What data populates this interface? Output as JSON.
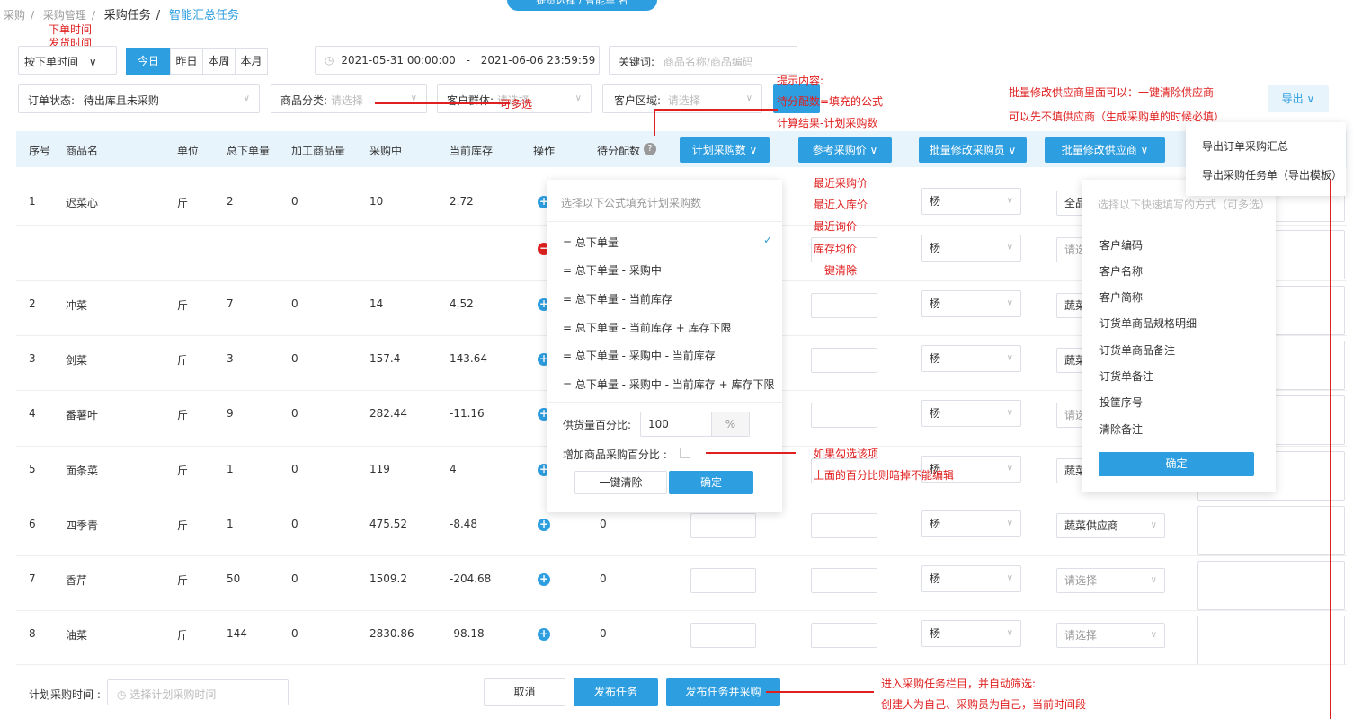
{
  "breadcrumb": {
    "items": [
      "采购",
      "采购管理",
      "采购任务",
      "智能汇总任务"
    ],
    "sep": "/"
  },
  "top_tab": "提货选择 / 智能单 名",
  "filters": {
    "time_type": "按下单时间",
    "time_options": [
      "下单时间",
      "发货时间"
    ],
    "quick_dates": [
      "今日",
      "昨日",
      "本周",
      "本月"
    ],
    "date_start": "2021-05-31 00:00:00",
    "date_sep": "-",
    "date_end": "2021-06-06 23:59:59",
    "keyword_label": "关键词:",
    "keyword_ph": "商品名称/商品编码",
    "order_status_label": "订单状态:",
    "order_status_value": "待出库且未采购",
    "category_label": "商品分类:",
    "category_ph": "请选择",
    "group_label": "客户群体:",
    "group_ph": "请选择",
    "region_label": "客户区域:",
    "region_ph": "请选择",
    "export": "导出"
  },
  "table": {
    "headers": [
      "序号",
      "商品名",
      "单位",
      "总下单量",
      "加工商品量",
      "采购中",
      "当前库存",
      "操作",
      "待分配数"
    ],
    "hbtns": [
      "计划采购数",
      "参考采购价",
      "批量修改采购员",
      "批量修改供应商"
    ],
    "rows": [
      {
        "no": "1",
        "name": "迟菜心",
        "unit": "斤",
        "total": "2",
        "proc": "0",
        "buying": "10",
        "stock": "2.72",
        "alloc": "",
        "buyer": "杨",
        "supplier": "全品"
      },
      {
        "no": "",
        "name": "",
        "unit": "",
        "total": "",
        "proc": "",
        "buying": "",
        "stock": "",
        "alloc": "",
        "buyer": "杨",
        "supplier": "请选"
      },
      {
        "no": "2",
        "name": "冲菜",
        "unit": "斤",
        "total": "7",
        "proc": "0",
        "buying": "14",
        "stock": "4.52",
        "alloc": "",
        "buyer": "杨",
        "supplier": "蔬菜"
      },
      {
        "no": "3",
        "name": "剑菜",
        "unit": "斤",
        "total": "3",
        "proc": "0",
        "buying": "157.4",
        "stock": "143.64",
        "alloc": "",
        "buyer": "杨",
        "supplier": "蔬菜"
      },
      {
        "no": "4",
        "name": "番薯叶",
        "unit": "斤",
        "total": "9",
        "proc": "0",
        "buying": "282.44",
        "stock": "-11.16",
        "alloc": "",
        "buyer": "杨",
        "supplier": "请选"
      },
      {
        "no": "5",
        "name": "面条菜",
        "unit": "斤",
        "total": "1",
        "proc": "0",
        "buying": "119",
        "stock": "4",
        "alloc": "",
        "buyer": "杨",
        "supplier": "蔬菜"
      },
      {
        "no": "6",
        "name": "四季青",
        "unit": "斤",
        "total": "1",
        "proc": "0",
        "buying": "475.52",
        "stock": "-8.48",
        "alloc": "0",
        "buyer": "杨",
        "supplier": "蔬菜供应商"
      },
      {
        "no": "7",
        "name": "香芹",
        "unit": "斤",
        "total": "50",
        "proc": "0",
        "buying": "1509.2",
        "stock": "-204.68",
        "alloc": "0",
        "buyer": "杨",
        "supplier": "请选择"
      },
      {
        "no": "8",
        "name": "油菜",
        "unit": "斤",
        "total": "144",
        "proc": "0",
        "buying": "2830.86",
        "stock": "-98.18",
        "alloc": "0",
        "buyer": "杨",
        "supplier": "请选择"
      }
    ]
  },
  "formula_popup": {
    "title": "选择以下公式填充计划采购数",
    "items": [
      "= 总下单量",
      "= 总下单量 - 采购中",
      "= 总下单量 - 当前库存",
      "= 总下单量 - 当前库存 + 库存下限",
      "= 总下单量 - 采购中 - 当前库存",
      "= 总下单量 - 采购中 - 当前库存 + 库存下限"
    ],
    "pct_label": "供货量百分比:",
    "pct_value": "100",
    "pct_unit": "%",
    "add_pct_label": "增加商品采购百分比 :",
    "clear": "一键清除",
    "confirm": "确定"
  },
  "supplier_popup": {
    "title": "选择以下快速填写的方式（可多选）",
    "items": [
      "客户编码",
      "客户名称",
      "客户简称",
      "订货单商品规格明细",
      "订货单商品备注",
      "订货单备注",
      "投筐序号",
      "清除备注"
    ],
    "confirm": "确定"
  },
  "export_menu": [
    "导出订单采购汇总",
    "导出采购任务单（导出模板）"
  ],
  "footer": {
    "plan_time_label": "计划采购时间 :",
    "plan_time_ph": "选择计划采购时间",
    "cancel": "取消",
    "publish": "发布任务",
    "publish_buy": "发布任务并采购"
  },
  "annotations": {
    "tip_title": "提示内容:",
    "tip_line1": "待分配数=填充的公式",
    "tip_line2": "计算结果-计划采购数",
    "multi": "可多选",
    "price_opts": [
      "最近采购价",
      "最近入库价",
      "最近询价",
      "库存均价",
      "一键清除"
    ],
    "supplier_note1": "批量修改供应商里面可以：一键清除供应商",
    "supplier_note2": "可以先不填供应商（生成采购单的时候必填）",
    "check_note1": "如果勾选该项",
    "check_note2": "上面的百分比则暗掉不能编辑",
    "footer_note1": "进入采购任务栏目，并自动筛选:",
    "footer_note2": "创建人为自己、采购员为自己，当前时间段"
  },
  "colors": {
    "accent": "#2d9ee0",
    "annotation": "#e02020",
    "header_bg": "#e8f4fc"
  }
}
